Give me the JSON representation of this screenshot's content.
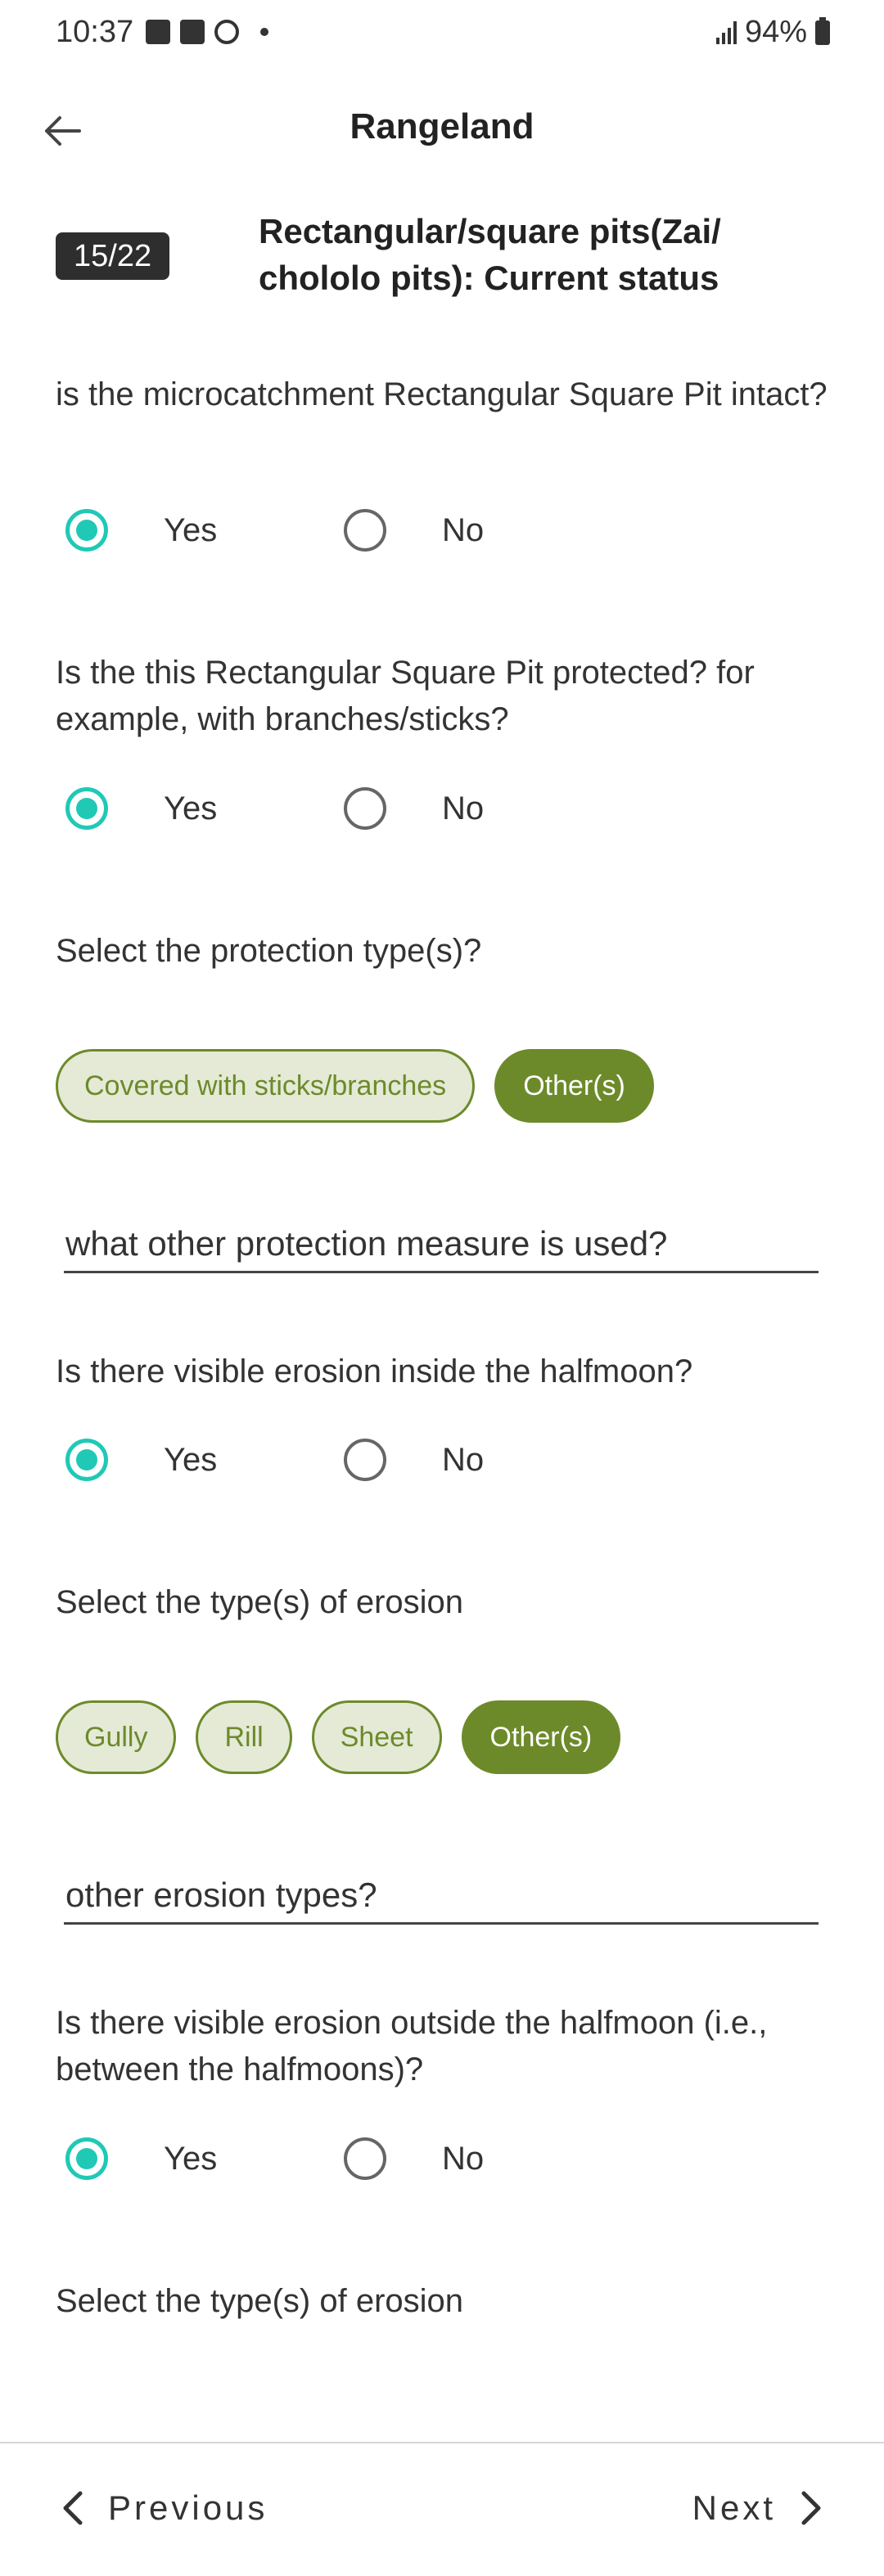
{
  "status_bar": {
    "time": "10:37",
    "battery": "94%"
  },
  "header": {
    "title": "Rangeland",
    "back_icon": "arrow-left-icon"
  },
  "section": {
    "badge": "15/22",
    "title": "Rectangular/square pits(Zai/ chololo pits): Current status"
  },
  "questions": {
    "q1": {
      "text": "is the microcatchment Rectangular Square Pit intact?",
      "yes": "Yes",
      "no": "No",
      "selected": "Yes"
    },
    "q2": {
      "text": "Is the this Rectangular Square Pit protected? for example, with branches/sticks?",
      "yes": "Yes",
      "no": "No",
      "selected": "Yes"
    },
    "q3": {
      "text": "Select the protection type(s)?",
      "chips": [
        {
          "label": "Covered with sticks/branches",
          "selected": false
        },
        {
          "label": "Other(s)",
          "selected": true
        }
      ]
    },
    "q4": {
      "placeholder": "what other protection measure is used?"
    },
    "q5": {
      "text": "Is there visible erosion inside the halfmoon?",
      "yes": "Yes",
      "no": "No",
      "selected": "Yes"
    },
    "q6": {
      "text": "Select the type(s) of erosion",
      "chips": [
        {
          "label": "Gully",
          "selected": false
        },
        {
          "label": "Rill",
          "selected": false
        },
        {
          "label": "Sheet",
          "selected": false
        },
        {
          "label": "Other(s)",
          "selected": true
        }
      ]
    },
    "q7": {
      "placeholder": "other erosion types?"
    },
    "q8": {
      "text": "Is there visible erosion outside the halfmoon (i.e., between the halfmoons)?",
      "yes": "Yes",
      "no": "No",
      "selected": "Yes"
    },
    "q9": {
      "text": "Select the type(s) of erosion"
    }
  },
  "footer": {
    "previous": "Previous",
    "next": "Next"
  },
  "colors": {
    "radio_selected": "#1fc9b6",
    "chip_accent": "#6d8a2a",
    "chip_bg": "#e4ead6"
  }
}
